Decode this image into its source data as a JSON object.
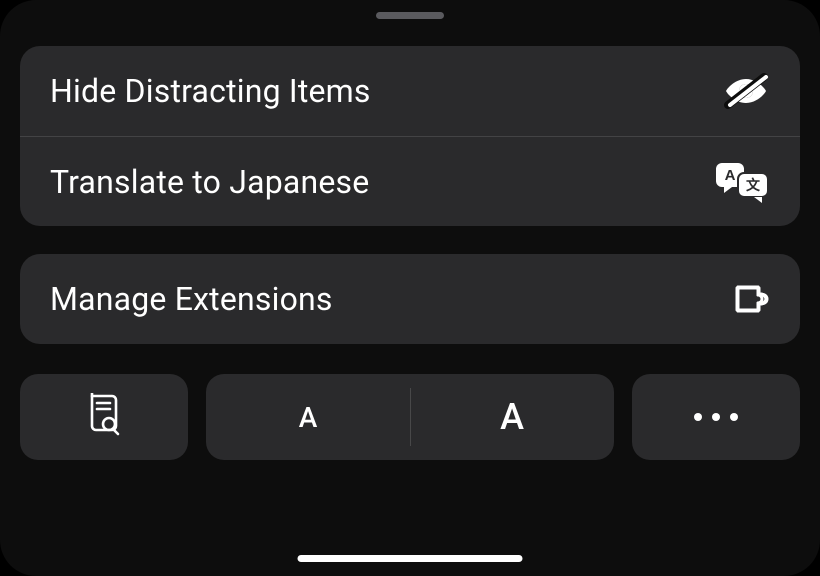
{
  "menu": {
    "hide_distracting": "Hide Distracting Items",
    "translate": "Translate to Japanese",
    "manage_extensions": "Manage Extensions"
  },
  "text_size": {
    "small": "A",
    "large": "A"
  }
}
